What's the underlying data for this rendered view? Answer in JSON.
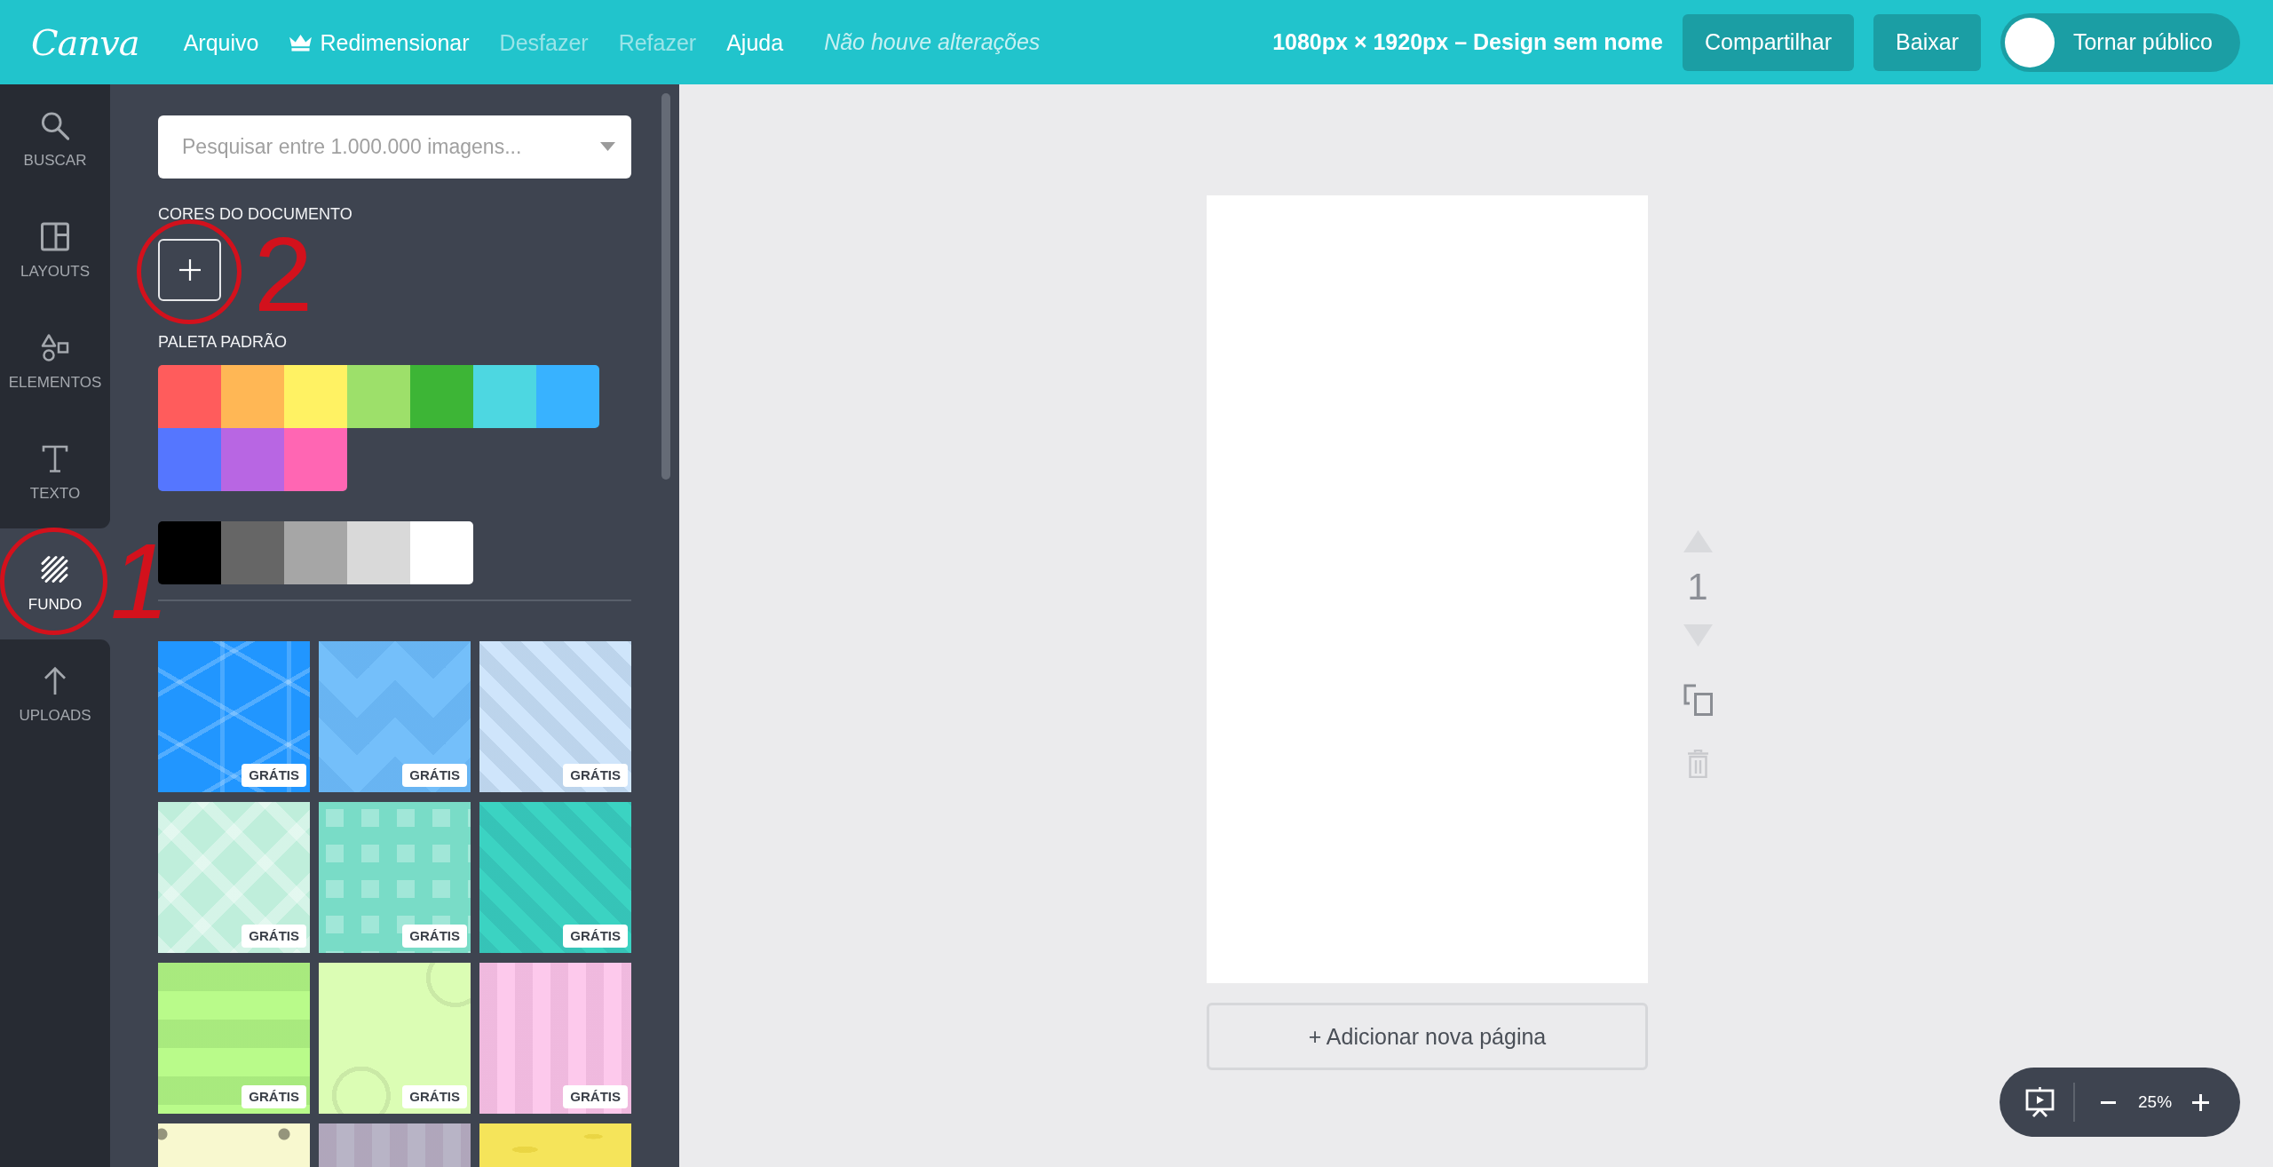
{
  "top_bar": {
    "logo": "Canva",
    "menu": [
      {
        "label": "Arquivo",
        "kind": "text",
        "disabled": false
      },
      {
        "label": "Redimensionar",
        "kind": "premium",
        "disabled": false
      },
      {
        "label": "Desfazer",
        "kind": "text",
        "disabled": true
      },
      {
        "label": "Refazer",
        "kind": "text",
        "disabled": true
      },
      {
        "label": "Ajuda",
        "kind": "text",
        "disabled": false
      }
    ],
    "save_status": "Não houve alterações",
    "document_title": "1080px × 1920px – Design sem nome",
    "buttons": [
      "Compartilhar",
      "Baixar"
    ],
    "public_toggle": {
      "label": "Tornar público",
      "on": false
    }
  },
  "sidebar": {
    "items": [
      {
        "label": "BUSCAR",
        "selected": false
      },
      {
        "label": "LAYOUTS",
        "selected": false
      },
      {
        "label": "ELEMENTOS",
        "selected": false
      },
      {
        "label": "TEXTO",
        "selected": false
      },
      {
        "label": "FUNDO",
        "selected": true,
        "annotation": "1"
      },
      {
        "label": "UPLOADS",
        "selected": false
      }
    ]
  },
  "panel": {
    "search": {
      "placeholder": "Pesquisar entre 1.000.000 imagens..."
    },
    "document_colors": {
      "title": "CORES DO DOCUMENTO",
      "annotation": "2"
    },
    "default_palette": {
      "title": "PALETA PADRÃO",
      "colors": [
        {
          "color": "#ff5c5c"
        },
        {
          "color": "#ffb755"
        },
        {
          "color": "#fff263"
        },
        {
          "color": "#9de06a"
        },
        {
          "color": "#3db536"
        },
        {
          "color": "#4dd7e1"
        },
        {
          "color": "#38b2ff"
        },
        {
          "color": "#5576ff"
        },
        {
          "color": "#b866e3"
        },
        {
          "color": "#ff66b3"
        }
      ]
    },
    "neutral_colors": [
      {
        "color": "#000000"
      },
      {
        "color": "#666666"
      },
      {
        "color": "#a6a6a6"
      },
      {
        "color": "#d9d9d9"
      },
      {
        "color": "#ffffff"
      }
    ],
    "backgrounds": [
      {
        "kind": "hexagons",
        "color": "#2196ff",
        "badge": "GRÁTIS"
      },
      {
        "kind": "chevrons",
        "color": "#74bffa",
        "badge": "GRÁTIS"
      },
      {
        "kind": "diagonal-stripes",
        "color": "#cfe5fb",
        "badge": "GRÁTIS"
      },
      {
        "kind": "diamonds",
        "color": "#bfeedb",
        "badge": "GRÁTIS"
      },
      {
        "kind": "squares",
        "color": "#79dcc7",
        "badge": "GRÁTIS"
      },
      {
        "kind": "diagonal-stripes",
        "color": "#3bd3c2",
        "badge": "GRÁTIS"
      },
      {
        "kind": "horizontal-stripes",
        "color": "#b9fb8a",
        "badge": "GRÁTIS"
      },
      {
        "kind": "rings",
        "color": "#dbfdb4",
        "badge": "GRÁTIS"
      },
      {
        "kind": "vertical-stripes",
        "color": "#fdc9ec",
        "badge": "GRÁTIS"
      },
      {
        "kind": "dots",
        "color": "#f8f8cf"
      },
      {
        "kind": "vertical-stripes",
        "color": "#b8b4c6"
      },
      {
        "kind": "spots",
        "color": "#f5e45a"
      }
    ]
  },
  "editor": {
    "page_tools": {
      "move_up": {
        "disabled": true
      },
      "page_number": "1",
      "move_down": {
        "disabled": true
      },
      "duplicate": {
        "disabled": false
      },
      "delete": {
        "disabled": true
      }
    },
    "add_page_button": "+ Adicionar nova página",
    "zoom_control": {
      "value": "25%"
    }
  }
}
